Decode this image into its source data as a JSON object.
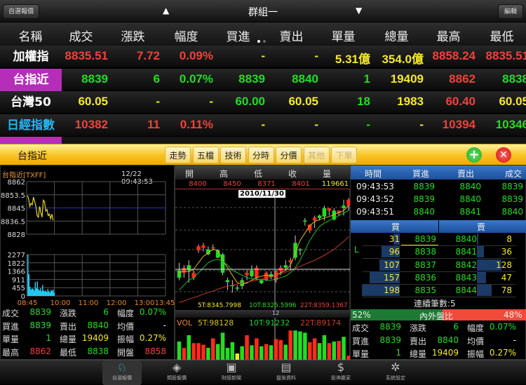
{
  "topbar": {
    "left_button": "自選報價",
    "group": "群組一",
    "right_button": "編輯"
  },
  "columns": [
    "名稱",
    "成交",
    "漲跌",
    "幅度",
    "買進",
    "賣出",
    "單量",
    "總量",
    "最高",
    "最低"
  ],
  "rows": [
    {
      "name": "加權指",
      "name_color": "w",
      "cells": [
        [
          "8835.51",
          "r"
        ],
        [
          "7.72",
          "r"
        ],
        [
          "0.09%",
          "r"
        ],
        [
          "-",
          "y"
        ],
        [
          "-",
          "y"
        ],
        [
          "5.31億",
          "y"
        ],
        [
          "354.0億",
          "y"
        ],
        [
          "8858.24",
          "r"
        ],
        [
          "8835.51",
          "r"
        ]
      ]
    },
    {
      "name": "台指近",
      "name_color": "w",
      "selected": true,
      "cells": [
        [
          "8839",
          "g"
        ],
        [
          "6",
          "g"
        ],
        [
          "0.07%",
          "g"
        ],
        [
          "8839",
          "g"
        ],
        [
          "8840",
          "g"
        ],
        [
          "1",
          "g"
        ],
        [
          "19409",
          "y"
        ],
        [
          "8862",
          "r"
        ],
        [
          "8838",
          "g"
        ]
      ]
    },
    {
      "name": "台灣50",
      "name_color": "w",
      "cells": [
        [
          "60.05",
          "y"
        ],
        [
          "-",
          "y"
        ],
        [
          "-",
          "y"
        ],
        [
          "60.00",
          "g"
        ],
        [
          "60.05",
          "y"
        ],
        [
          "18",
          "g"
        ],
        [
          "1983",
          "y"
        ],
        [
          "60.40",
          "r"
        ],
        [
          "60.05",
          "y"
        ]
      ]
    },
    {
      "name": "日經指數",
      "name_color": "c",
      "cells": [
        [
          "10382",
          "r"
        ],
        [
          "11",
          "r"
        ],
        [
          "0.11%",
          "r"
        ],
        [
          "-",
          "y"
        ],
        [
          "-",
          "y"
        ],
        [
          "-",
          "g"
        ],
        [
          "-",
          "y"
        ],
        [
          "10394",
          "r"
        ],
        [
          "10346",
          "g"
        ]
      ]
    }
  ],
  "detail_bar": {
    "title": "台指近",
    "tabs": [
      {
        "label": "走勢",
        "enabled": true
      },
      {
        "label": "五檔",
        "enabled": true
      },
      {
        "label": "技術",
        "enabled": true
      },
      {
        "label": "分時",
        "enabled": true
      },
      {
        "label": "分價",
        "enabled": true
      },
      {
        "label": "其他",
        "enabled": false
      },
      {
        "label": "下單",
        "enabled": false
      }
    ],
    "add_icon": "plus-circle-icon",
    "close_icon": "close-circle-icon"
  },
  "trend": {
    "title": "台指近[TXFF]",
    "datetime": "12/22 09:43:53",
    "price_ticks": [
      "8862",
      "8853.5",
      "8845",
      "8836.5",
      "8828"
    ],
    "vol_ticks": [
      "2277",
      "1822",
      "1366",
      "911",
      "455",
      "0"
    ],
    "time_ticks": [
      "08:45",
      "10:00",
      "11:00",
      "12:00",
      "13:00",
      "13:45"
    ],
    "price_range": [
      8828,
      8862
    ],
    "ref_price": 8845,
    "prices": [
      8853,
      8851,
      8846,
      8848,
      8847,
      8852,
      8849,
      8846,
      8840,
      8839,
      8846,
      8842,
      8839,
      8850,
      8849,
      8843,
      8844,
      8840,
      8841,
      8838,
      8841,
      8837
    ],
    "volumes": [
      2277,
      1200,
      500,
      350,
      420,
      380,
      300,
      760,
      420,
      800,
      380,
      300,
      420,
      260,
      600,
      300,
      250,
      300,
      220,
      380,
      260,
      200,
      330,
      280,
      360,
      200
    ],
    "stats": [
      [
        "成交",
        "8839",
        "g"
      ],
      [
        "漲跌",
        "6",
        "g"
      ],
      [
        "幅度",
        "0.07%",
        "g"
      ],
      [
        "買進",
        "8839",
        "g"
      ],
      [
        "賣出",
        "8840",
        "g"
      ],
      [
        "均價",
        "-",
        "w"
      ],
      [
        "單量",
        "1",
        "g"
      ],
      [
        "總量",
        "19409",
        "y"
      ],
      [
        "振幅",
        "0.27%",
        "y"
      ],
      [
        "最高",
        "8862",
        "r"
      ],
      [
        "最低",
        "8838",
        "g"
      ],
      [
        "開盤",
        "8858",
        "r"
      ]
    ]
  },
  "tech": {
    "headers": [
      "開",
      "高",
      "低",
      "收",
      "量"
    ],
    "values": [
      "8400",
      "8450",
      "8371",
      "8401",
      "119661"
    ],
    "cursor_date": "2010/11/30",
    "ma_labels": [
      "5T:8345.7998",
      "10T:8325.5996",
      "22T:8359.1367"
    ],
    "cursor_marker": "12",
    "vol_labels": [
      "VOL",
      "5T:98128",
      "10T:91232",
      "22T:89174"
    ],
    "chart_data": {
      "type": "candlestick",
      "yrange": [
        8240,
        8480
      ],
      "ohlc": [
        [
          8320,
          8335,
          8300,
          8305
        ],
        [
          8315,
          8330,
          8305,
          8325
        ],
        [
          8330,
          8340,
          8295,
          8320
        ],
        [
          8305,
          8320,
          8300,
          8315
        ],
        [
          8360,
          8372,
          8355,
          8368
        ],
        [
          8365,
          8375,
          8358,
          8370
        ],
        [
          8362,
          8368,
          8350,
          8352
        ],
        [
          8365,
          8372,
          8360,
          8366
        ],
        [
          8360,
          8362,
          8345,
          8345
        ],
        [
          8352,
          8355,
          8310,
          8315
        ],
        [
          8300,
          8305,
          8280,
          8296
        ],
        [
          8290,
          8300,
          8275,
          8288
        ],
        [
          8285,
          8290,
          8278,
          8284
        ],
        [
          8300,
          8305,
          8282,
          8288
        ],
        [
          8310,
          8320,
          8300,
          8315
        ],
        [
          8320,
          8330,
          8305,
          8308
        ],
        [
          8305,
          8330,
          8300,
          8325
        ],
        [
          8300,
          8302,
          8292,
          8294
        ],
        [
          8300,
          8318,
          8298,
          8315
        ],
        [
          8312,
          8318,
          8302,
          8306
        ],
        [
          8300,
          8320,
          8295,
          8318
        ],
        [
          8318,
          8330,
          8310,
          8325
        ],
        [
          8330,
          8340,
          8320,
          8325
        ],
        [
          8336,
          8345,
          8320,
          8340
        ],
        [
          8375,
          8390,
          8340,
          8345
        ],
        [
          8362,
          8365,
          8350,
          8360
        ],
        [
          8420,
          8425,
          8410,
          8418
        ],
        [
          8400,
          8410,
          8395,
          8412
        ],
        [
          8420,
          8430,
          8405,
          8426
        ],
        [
          8430,
          8432,
          8420,
          8425
        ],
        [
          8445,
          8450,
          8420,
          8428
        ],
        [
          8440,
          8445,
          8430,
          8445
        ],
        [
          8440,
          8445,
          8420,
          8422
        ],
        [
          8435,
          8440,
          8430,
          8440
        ],
        [
          8450,
          8462,
          8430,
          8445
        ],
        [
          8450,
          8465,
          8440,
          8462
        ]
      ],
      "volumes": [
        60,
        40,
        80,
        55,
        55,
        50,
        40,
        70,
        52,
        88,
        40,
        58,
        22,
        45,
        80,
        48,
        70,
        45,
        52,
        48,
        68,
        65,
        50,
        95,
        95,
        92,
        88,
        58,
        70,
        55,
        80,
        55,
        60,
        62,
        75,
        15
      ],
      "ma5": [
        8315,
        8318,
        8317,
        8322,
        8335,
        8348,
        8355,
        8362,
        8360,
        8340,
        8325,
        8310,
        8295,
        8292,
        8294,
        8300,
        8305,
        8308,
        8310,
        8308,
        8310,
        8315,
        8320,
        8330,
        8355,
        8380,
        8395,
        8410,
        8418,
        8422,
        8425,
        8428,
        8432,
        8436,
        8440,
        8450
      ],
      "ma10": [
        8280,
        8290,
        8300,
        8305,
        8315,
        8325,
        8335,
        8340,
        8342,
        8338,
        8330,
        8320,
        8315,
        8310,
        8305,
        8303,
        8302,
        8302,
        8300,
        8300,
        8302,
        8305,
        8308,
        8315,
        8325,
        8340,
        8360,
        8380,
        8395,
        8408,
        8415,
        8420,
        8425,
        8430,
        8435,
        8440
      ],
      "ma22": [
        8255,
        8258,
        8262,
        8265,
        8268,
        8272,
        8275,
        8278,
        8282,
        8285,
        8288,
        8290,
        8292,
        8294,
        8296,
        8298,
        8300,
        8302,
        8304,
        8307,
        8310,
        8313,
        8316,
        8320,
        8324,
        8328,
        8332,
        8336,
        8340,
        8345,
        8350,
        8356,
        8362,
        8370,
        8378,
        8388
      ]
    }
  },
  "book": {
    "tick_headers": [
      "時間",
      "買進",
      "賣出",
      "成交"
    ],
    "ticks": [
      [
        "09:43:53",
        "8839",
        "8840",
        "8839"
      ],
      [
        "09:43:52",
        "8839",
        "8840",
        "8839"
      ],
      [
        "09:43:51",
        "8840",
        "8841",
        "8840"
      ]
    ],
    "buy_label": "買",
    "sell_label": "賣",
    "side_marker": "L",
    "levels": [
      [
        31,
        "8839",
        "8840",
        8
      ],
      [
        96,
        "8838",
        "8841",
        36
      ],
      [
        107,
        "8837",
        "8842",
        128
      ],
      [
        157,
        "8836",
        "8843",
        47
      ],
      [
        198,
        "8835",
        "8844",
        78
      ]
    ],
    "consecutive": "連續筆數:5",
    "ratio_label": "內外盤比",
    "inner_pct": 52,
    "outer_pct": 48,
    "inner_text": "52%",
    "outer_text": "48%",
    "stats": [
      [
        "成交",
        "8839",
        "g"
      ],
      [
        "漲跌",
        "6",
        "g"
      ],
      [
        "幅度",
        "0.07%",
        "g"
      ],
      [
        "買進",
        "8839",
        "g"
      ],
      [
        "賣出",
        "8840",
        "g"
      ],
      [
        "均價",
        "-",
        "w"
      ],
      [
        "單量",
        "1",
        "g"
      ],
      [
        "總量",
        "19409",
        "y"
      ],
      [
        "振幅",
        "0.27%",
        "y"
      ]
    ]
  },
  "tabbar": [
    {
      "label": "自選報價",
      "icon": "person-icon",
      "active": true
    },
    {
      "label": "類股報價",
      "icon": "category-icon"
    },
    {
      "label": "財經新聞",
      "icon": "tv-icon"
    },
    {
      "label": "盤後資料",
      "icon": "document-icon"
    },
    {
      "label": "股神贏家",
      "icon": "dollar-icon"
    },
    {
      "label": "系統設定",
      "icon": "gears-icon"
    }
  ],
  "colors": {
    "red": "#f0413a",
    "green": "#22dd22",
    "yellow": "#f5e92a",
    "selected": "#b52db8",
    "cyan": "#26b6f0"
  }
}
